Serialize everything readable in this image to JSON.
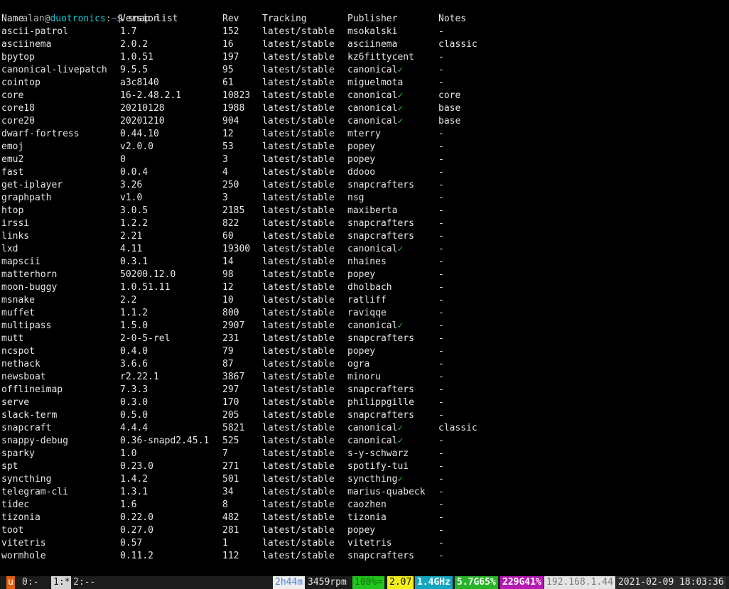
{
  "prompt": {
    "user": "alan",
    "at": "@",
    "host": "duotronics",
    "colon": ":",
    "path": "~",
    "sign": "$"
  },
  "command": "snap list",
  "headers": {
    "name": "Name",
    "version": "Version",
    "rev": "Rev",
    "tracking": "Tracking",
    "publisher": "Publisher",
    "notes": "Notes"
  },
  "verified_mark": "✓",
  "rows": [
    {
      "name": "ascii-patrol",
      "version": "1.7",
      "rev": "152",
      "tracking": "latest/stable",
      "publisher": "msokalski",
      "verified": false,
      "notes": "-"
    },
    {
      "name": "asciinema",
      "version": "2.0.2",
      "rev": "16",
      "tracking": "latest/stable",
      "publisher": "asciinema",
      "verified": false,
      "notes": "classic"
    },
    {
      "name": "bpytop",
      "version": "1.0.51",
      "rev": "197",
      "tracking": "latest/stable",
      "publisher": "kz6fittycent",
      "verified": false,
      "notes": "-"
    },
    {
      "name": "canonical-livepatch",
      "version": "9.5.5",
      "rev": "95",
      "tracking": "latest/stable",
      "publisher": "canonical",
      "verified": true,
      "notes": "-"
    },
    {
      "name": "cointop",
      "version": "a3c8140",
      "rev": "61",
      "tracking": "latest/stable",
      "publisher": "miguelmota",
      "verified": false,
      "notes": "-"
    },
    {
      "name": "core",
      "version": "16-2.48.2.1",
      "rev": "10823",
      "tracking": "latest/stable",
      "publisher": "canonical",
      "verified": true,
      "notes": "core"
    },
    {
      "name": "core18",
      "version": "20210128",
      "rev": "1988",
      "tracking": "latest/stable",
      "publisher": "canonical",
      "verified": true,
      "notes": "base"
    },
    {
      "name": "core20",
      "version": "20201210",
      "rev": "904",
      "tracking": "latest/stable",
      "publisher": "canonical",
      "verified": true,
      "notes": "base"
    },
    {
      "name": "dwarf-fortress",
      "version": "0.44.10",
      "rev": "12",
      "tracking": "latest/stable",
      "publisher": "mterry",
      "verified": false,
      "notes": "-"
    },
    {
      "name": "emoj",
      "version": "v2.0.0",
      "rev": "53",
      "tracking": "latest/stable",
      "publisher": "popey",
      "verified": false,
      "notes": "-"
    },
    {
      "name": "emu2",
      "version": "0",
      "rev": "3",
      "tracking": "latest/stable",
      "publisher": "popey",
      "verified": false,
      "notes": "-"
    },
    {
      "name": "fast",
      "version": "0.0.4",
      "rev": "4",
      "tracking": "latest/stable",
      "publisher": "ddooo",
      "verified": false,
      "notes": "-"
    },
    {
      "name": "get-iplayer",
      "version": "3.26",
      "rev": "250",
      "tracking": "latest/stable",
      "publisher": "snapcrafters",
      "verified": false,
      "notes": "-"
    },
    {
      "name": "graphpath",
      "version": "v1.0",
      "rev": "3",
      "tracking": "latest/stable",
      "publisher": "nsg",
      "verified": false,
      "notes": "-"
    },
    {
      "name": "htop",
      "version": "3.0.5",
      "rev": "2185",
      "tracking": "latest/stable",
      "publisher": "maxiberta",
      "verified": false,
      "notes": "-"
    },
    {
      "name": "irssi",
      "version": "1.2.2",
      "rev": "822",
      "tracking": "latest/stable",
      "publisher": "snapcrafters",
      "verified": false,
      "notes": "-"
    },
    {
      "name": "links",
      "version": "2.21",
      "rev": "60",
      "tracking": "latest/stable",
      "publisher": "snapcrafters",
      "verified": false,
      "notes": "-"
    },
    {
      "name": "lxd",
      "version": "4.11",
      "rev": "19300",
      "tracking": "latest/stable",
      "publisher": "canonical",
      "verified": true,
      "notes": "-"
    },
    {
      "name": "mapscii",
      "version": "0.3.1",
      "rev": "14",
      "tracking": "latest/stable",
      "publisher": "nhaines",
      "verified": false,
      "notes": "-"
    },
    {
      "name": "matterhorn",
      "version": "50200.12.0",
      "rev": "98",
      "tracking": "latest/stable",
      "publisher": "popey",
      "verified": false,
      "notes": "-"
    },
    {
      "name": "moon-buggy",
      "version": "1.0.51.11",
      "rev": "12",
      "tracking": "latest/stable",
      "publisher": "dholbach",
      "verified": false,
      "notes": "-"
    },
    {
      "name": "msnake",
      "version": "2.2",
      "rev": "10",
      "tracking": "latest/stable",
      "publisher": "ratliff",
      "verified": false,
      "notes": "-"
    },
    {
      "name": "muffet",
      "version": "1.1.2",
      "rev": "800",
      "tracking": "latest/stable",
      "publisher": "raviqqe",
      "verified": false,
      "notes": "-"
    },
    {
      "name": "multipass",
      "version": "1.5.0",
      "rev": "2907",
      "tracking": "latest/stable",
      "publisher": "canonical",
      "verified": true,
      "notes": "-"
    },
    {
      "name": "mutt",
      "version": "2-0-5-rel",
      "rev": "231",
      "tracking": "latest/stable",
      "publisher": "snapcrafters",
      "verified": false,
      "notes": "-"
    },
    {
      "name": "ncspot",
      "version": "0.4.0",
      "rev": "79",
      "tracking": "latest/stable",
      "publisher": "popey",
      "verified": false,
      "notes": "-"
    },
    {
      "name": "nethack",
      "version": "3.6.6",
      "rev": "87",
      "tracking": "latest/stable",
      "publisher": "ogra",
      "verified": false,
      "notes": "-"
    },
    {
      "name": "newsboat",
      "version": "r2.22.1",
      "rev": "3867",
      "tracking": "latest/stable",
      "publisher": "minoru",
      "verified": false,
      "notes": "-"
    },
    {
      "name": "offlineimap",
      "version": "7.3.3",
      "rev": "297",
      "tracking": "latest/stable",
      "publisher": "snapcrafters",
      "verified": false,
      "notes": "-"
    },
    {
      "name": "serve",
      "version": "0.3.0",
      "rev": "170",
      "tracking": "latest/stable",
      "publisher": "philippgille",
      "verified": false,
      "notes": "-"
    },
    {
      "name": "slack-term",
      "version": "0.5.0",
      "rev": "205",
      "tracking": "latest/stable",
      "publisher": "snapcrafters",
      "verified": false,
      "notes": "-"
    },
    {
      "name": "snapcraft",
      "version": "4.4.4",
      "rev": "5821",
      "tracking": "latest/stable",
      "publisher": "canonical",
      "verified": true,
      "notes": "classic"
    },
    {
      "name": "snappy-debug",
      "version": "0.36-snapd2.45.1",
      "rev": "525",
      "tracking": "latest/stable",
      "publisher": "canonical",
      "verified": true,
      "notes": "-"
    },
    {
      "name": "sparky",
      "version": "1.0",
      "rev": "7",
      "tracking": "latest/stable",
      "publisher": "s-y-schwarz",
      "verified": false,
      "notes": "-"
    },
    {
      "name": "spt",
      "version": "0.23.0",
      "rev": "271",
      "tracking": "latest/stable",
      "publisher": "spotify-tui",
      "verified": false,
      "notes": "-"
    },
    {
      "name": "syncthing",
      "version": "1.4.2",
      "rev": "501",
      "tracking": "latest/stable",
      "publisher": "syncthing",
      "verified": true,
      "notes": "-"
    },
    {
      "name": "telegram-cli",
      "version": "1.3.1",
      "rev": "34",
      "tracking": "latest/stable",
      "publisher": "marius-quabeck",
      "verified": false,
      "notes": "-"
    },
    {
      "name": "tidec",
      "version": "1.6",
      "rev": "8",
      "tracking": "latest/stable",
      "publisher": "caozhen",
      "verified": false,
      "notes": "-"
    },
    {
      "name": "tizonia",
      "version": "0.22.0",
      "rev": "482",
      "tracking": "latest/stable",
      "publisher": "tizonia",
      "verified": false,
      "notes": "-"
    },
    {
      "name": "toot",
      "version": "0.27.0",
      "rev": "281",
      "tracking": "latest/stable",
      "publisher": "popey",
      "verified": false,
      "notes": "-"
    },
    {
      "name": "vitetris",
      "version": "0.57",
      "rev": "1",
      "tracking": "latest/stable",
      "publisher": "vitetris",
      "verified": false,
      "notes": "-"
    },
    {
      "name": "wormhole",
      "version": "0.11.2",
      "rev": "112",
      "tracking": "latest/stable",
      "publisher": "snapcrafters",
      "verified": false,
      "notes": "-"
    }
  ],
  "statusbar": {
    "session": "u",
    "windows": [
      {
        "label": "0:-",
        "active": false
      },
      {
        "label": "1:*",
        "active": true
      },
      {
        "label": "2:--",
        "active": false
      }
    ],
    "uptime": "2h44m",
    "fan": "3459rpm",
    "battery": "100%=",
    "load": "2.07",
    "cpu_freq": "1.4GHz",
    "memory": "5.7G65%",
    "disk": "229G41%",
    "ip": "192.168.1.44",
    "datetime": "2021-02-09 18:03:36"
  }
}
